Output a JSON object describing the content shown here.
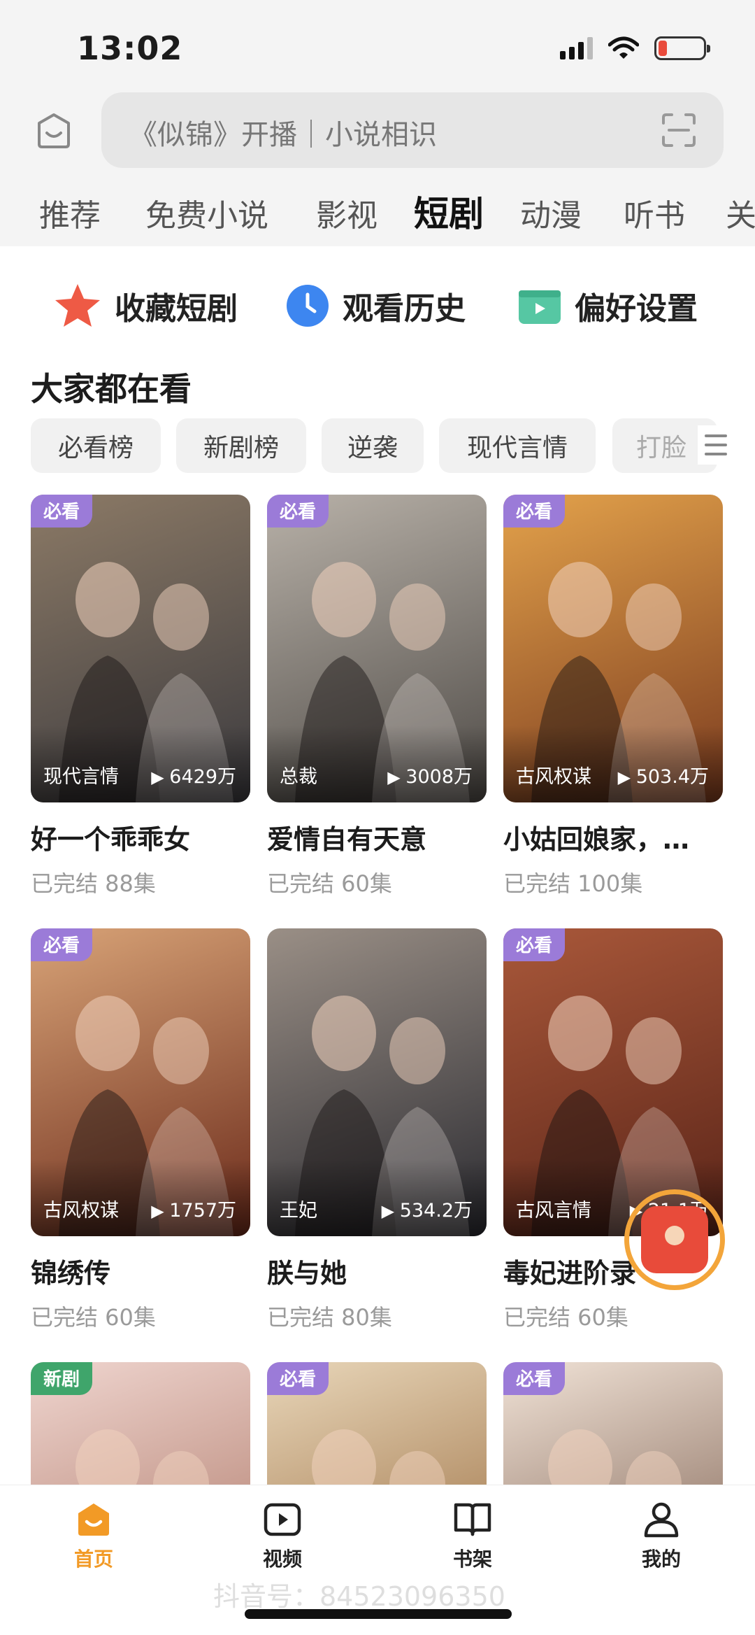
{
  "status": {
    "time": "13:02",
    "battery_level": 0.2
  },
  "search": {
    "placeholder": "《似锦》开播｜小说相识"
  },
  "tabs": [
    {
      "label": "推荐"
    },
    {
      "label": "免费小说"
    },
    {
      "label": "影视"
    },
    {
      "label": "短剧",
      "active": true
    },
    {
      "label": "动漫"
    },
    {
      "label": "听书"
    },
    {
      "label": "关"
    }
  ],
  "quick_actions": [
    {
      "label": "收藏短剧",
      "icon": "star-icon"
    },
    {
      "label": "观看历史",
      "icon": "clock-icon"
    },
    {
      "label": "偏好设置",
      "icon": "tv-icon"
    }
  ],
  "section": {
    "title": "大家都在看"
  },
  "filters": [
    {
      "label": "必看榜"
    },
    {
      "label": "新剧榜"
    },
    {
      "label": "逆袭"
    },
    {
      "label": "现代言情"
    },
    {
      "label": "打脸"
    }
  ],
  "dramas": [
    {
      "badge": "必看",
      "genre": "现代言情",
      "plays": "6429万",
      "title": "好一个乖乖女",
      "meta": "已完结  88集",
      "colors": [
        "#3b3a3e",
        "#8c7a66"
      ]
    },
    {
      "badge": "必看",
      "genre": "总裁",
      "plays": "3008万",
      "title": "爱情自有天意",
      "meta": "已完结  60集",
      "colors": [
        "#4e4a46",
        "#b8b1a8"
      ]
    },
    {
      "badge": "必看",
      "genre": "古风权谋",
      "plays": "503.4万",
      "title": "小姑回娘家，…",
      "meta": "已完结  100集",
      "colors": [
        "#7a3a1e",
        "#e3a24b"
      ]
    },
    {
      "badge": "必看",
      "genre": "古风权谋",
      "plays": "1757万",
      "title": "锦绣传",
      "meta": "已完结  60集",
      "colors": [
        "#6b2a1a",
        "#d8a377"
      ]
    },
    {
      "badge": "",
      "genre": "王妃",
      "plays": "534.2万",
      "title": "朕与她",
      "meta": "已完结  80集",
      "colors": [
        "#2a2a30",
        "#9a8f86"
      ]
    },
    {
      "badge": "必看",
      "genre": "古风言情",
      "plays": "21.1万",
      "title": "毒妃进阶录",
      "meta": "已完结  60集",
      "colors": [
        "#5a2418",
        "#a9583a"
      ]
    },
    {
      "badge": "新剧",
      "genre": "",
      "plays": "",
      "title": "",
      "meta": "",
      "colors": [
        "#a46a58",
        "#efd5cf"
      ]
    },
    {
      "badge": "必看",
      "genre": "",
      "plays": "",
      "title": "",
      "meta": "",
      "colors": [
        "#8c5a2a",
        "#e8d6b9"
      ]
    },
    {
      "badge": "必看",
      "genre": "",
      "plays": "",
      "title": "",
      "meta": "",
      "colors": [
        "#6a4a3a",
        "#f0e2d6"
      ]
    }
  ],
  "nav": [
    {
      "label": "首页",
      "icon": "home-icon",
      "active": true
    },
    {
      "label": "视频",
      "icon": "video-icon"
    },
    {
      "label": "书架",
      "icon": "bookshelf-icon"
    },
    {
      "label": "我的",
      "icon": "profile-icon"
    }
  ],
  "watermark": "抖音号：84523096350",
  "colors": {
    "accent": "#f29a26",
    "badge_must_watch": "#9b7bd8",
    "badge_new": "#3fa56b"
  }
}
